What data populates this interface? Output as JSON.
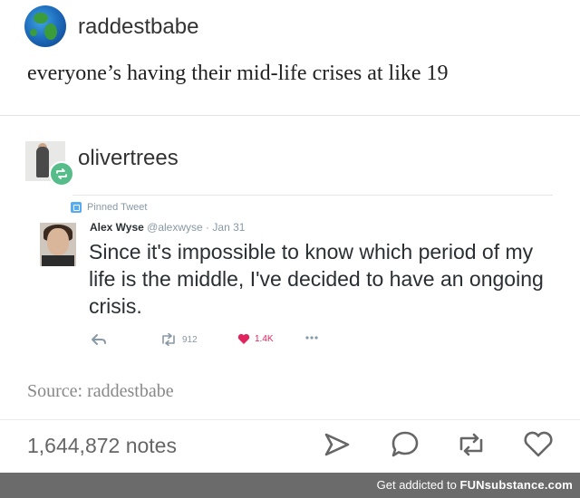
{
  "post": {
    "username": "raddestbabe",
    "text": "everyone’s having their mid-life crises at like 19"
  },
  "reblog": {
    "username": "olivertrees"
  },
  "tweet": {
    "pinned_label": "Pinned Tweet",
    "author_name": "Alex Wyse",
    "handle": "@alexwyse",
    "separator": "·",
    "date": "Jan 31",
    "text": "Since it's impossible to know which period of my life is the middle, I've decided to have an ongoing crisis.",
    "retweets": "912",
    "likes": "1.4K",
    "colors": {
      "like": "#e0245e",
      "meta": "#8899a6"
    }
  },
  "footer": {
    "source": "Source: raddestbabe",
    "notes": "1,644,872 notes",
    "icons": [
      "share-icon",
      "reply-icon",
      "reblog-icon",
      "like-icon"
    ]
  },
  "watermark": {
    "prefix": "Get addicted to",
    "brand": "FUNsubstance.com"
  },
  "colors": {
    "reblog_badge": "#56bc8a",
    "pin": "#55acee"
  }
}
